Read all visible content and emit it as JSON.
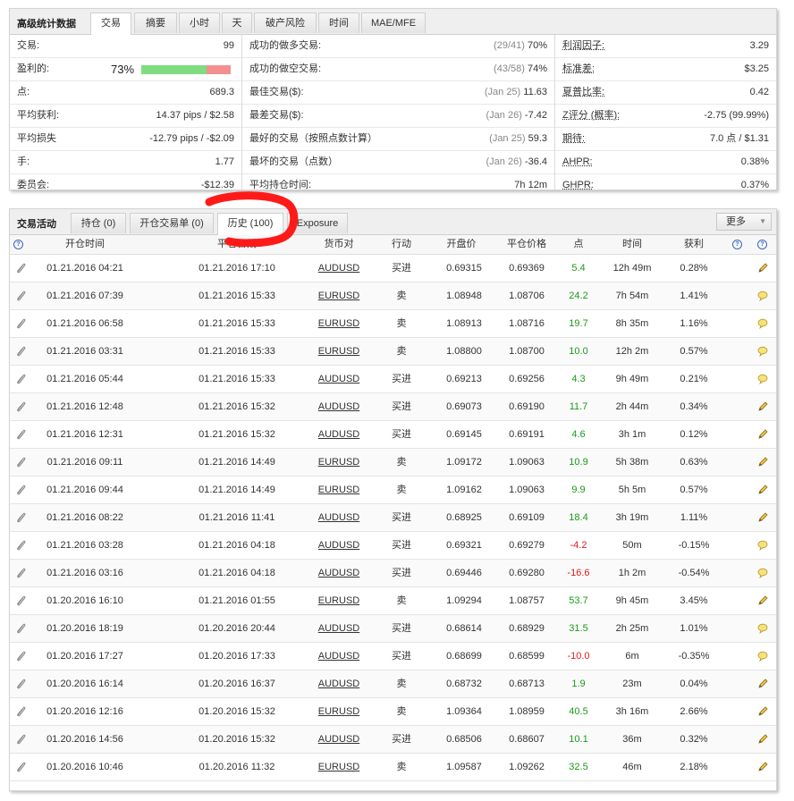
{
  "stats": {
    "title": "高级统计数据",
    "tabs": [
      "交易",
      "摘要",
      "小时",
      "天",
      "破产风险",
      "时间",
      "MAE/MFE"
    ],
    "active_tab": 0,
    "col1": [
      {
        "label": "交易:",
        "value": "99"
      },
      {
        "label": "盈利的:",
        "value": "73%",
        "win_fraction": 0.73
      },
      {
        "label": "点:",
        "value": "689.3"
      },
      {
        "label": "平均获利:",
        "value": "14.37 pips / $2.58"
      },
      {
        "label": "平均损失",
        "value": "-12.79 pips / -$2.09"
      },
      {
        "label": "手:",
        "value": "1.77"
      },
      {
        "label": "委员会:",
        "value": "-$12.39"
      }
    ],
    "col2": [
      {
        "label": "成功的做多交易:",
        "paren": "(29/41)",
        "value": "70%"
      },
      {
        "label": "成功的做空交易:",
        "paren": "(43/58)",
        "value": "74%"
      },
      {
        "label": "最佳交易($):",
        "paren": "(Jan 25)",
        "value": "11.63"
      },
      {
        "label": "最差交易($):",
        "paren": "(Jan 26)",
        "value": "-7.42"
      },
      {
        "label": "最好的交易（按照点数计算）",
        "paren": "(Jan 25)",
        "value": "59.3"
      },
      {
        "label": "最坏的交易（点数）",
        "paren": "(Jan 26)",
        "value": "-36.4"
      },
      {
        "label": "平均持仓时间:",
        "paren": "",
        "value": "7h 12m"
      }
    ],
    "col3": [
      {
        "label": "利润因子:",
        "value": "3.29"
      },
      {
        "label": "标准差:",
        "value": "$3.25"
      },
      {
        "label": "夏普比率:",
        "value": "0.42"
      },
      {
        "label": "Z评分 (概率):",
        "value": "-2.75 (99.99%)"
      },
      {
        "label": "期待:",
        "value": "7.0 点 / $1.31"
      },
      {
        "label": "AHPR:",
        "value": "0.38%"
      },
      {
        "label": "GHPR:",
        "value": "0.37%"
      }
    ]
  },
  "trades": {
    "title": "交易活动",
    "tabs": [
      "持仓 (0)",
      "开仓交易单 (0)",
      "历史 (100)",
      "Exposure"
    ],
    "active_tab": 2,
    "more_label": "更多",
    "headers": [
      "开仓时间",
      "平仓日期",
      "货币对",
      "行动",
      "开盘价",
      "平仓价格",
      "点",
      "时间",
      "获利"
    ],
    "rows": [
      {
        "open": "01.21.2016 04:21",
        "close": "01.21.2016 17:10",
        "symbol": "AUDUSD",
        "action": "买进",
        "open_price": "0.69315",
        "close_price": "0.69369",
        "pips": "5.4",
        "duration": "12h 49m",
        "profit": "0.28%",
        "icon": "pencil"
      },
      {
        "open": "01.21.2016 07:39",
        "close": "01.21.2016 15:33",
        "symbol": "EURUSD",
        "action": "卖",
        "open_price": "1.08948",
        "close_price": "1.08706",
        "pips": "24.2",
        "duration": "7h 54m",
        "profit": "1.41%",
        "icon": "comment"
      },
      {
        "open": "01.21.2016 06:58",
        "close": "01.21.2016 15:33",
        "symbol": "EURUSD",
        "action": "卖",
        "open_price": "1.08913",
        "close_price": "1.08716",
        "pips": "19.7",
        "duration": "8h 35m",
        "profit": "1.16%",
        "icon": "comment"
      },
      {
        "open": "01.21.2016 03:31",
        "close": "01.21.2016 15:33",
        "symbol": "EURUSD",
        "action": "卖",
        "open_price": "1.08800",
        "close_price": "1.08700",
        "pips": "10.0",
        "duration": "12h 2m",
        "profit": "0.57%",
        "icon": "comment"
      },
      {
        "open": "01.21.2016 05:44",
        "close": "01.21.2016 15:33",
        "symbol": "AUDUSD",
        "action": "买进",
        "open_price": "0.69213",
        "close_price": "0.69256",
        "pips": "4.3",
        "duration": "9h 49m",
        "profit": "0.21%",
        "icon": "comment"
      },
      {
        "open": "01.21.2016 12:48",
        "close": "01.21.2016 15:32",
        "symbol": "AUDUSD",
        "action": "买进",
        "open_price": "0.69073",
        "close_price": "0.69190",
        "pips": "11.7",
        "duration": "2h 44m",
        "profit": "0.34%",
        "icon": "pencil"
      },
      {
        "open": "01.21.2016 12:31",
        "close": "01.21.2016 15:32",
        "symbol": "AUDUSD",
        "action": "买进",
        "open_price": "0.69145",
        "close_price": "0.69191",
        "pips": "4.6",
        "duration": "3h 1m",
        "profit": "0.12%",
        "icon": "pencil"
      },
      {
        "open": "01.21.2016 09:11",
        "close": "01.21.2016 14:49",
        "symbol": "EURUSD",
        "action": "卖",
        "open_price": "1.09172",
        "close_price": "1.09063",
        "pips": "10.9",
        "duration": "5h 38m",
        "profit": "0.63%",
        "icon": "pencil"
      },
      {
        "open": "01.21.2016 09:44",
        "close": "01.21.2016 14:49",
        "symbol": "EURUSD",
        "action": "卖",
        "open_price": "1.09162",
        "close_price": "1.09063",
        "pips": "9.9",
        "duration": "5h 5m",
        "profit": "0.57%",
        "icon": "pencil"
      },
      {
        "open": "01.21.2016 08:22",
        "close": "01.21.2016 11:41",
        "symbol": "AUDUSD",
        "action": "买进",
        "open_price": "0.68925",
        "close_price": "0.69109",
        "pips": "18.4",
        "duration": "3h 19m",
        "profit": "1.11%",
        "icon": "pencil"
      },
      {
        "open": "01.21.2016 03:28",
        "close": "01.21.2016 04:18",
        "symbol": "AUDUSD",
        "action": "买进",
        "open_price": "0.69321",
        "close_price": "0.69279",
        "pips": "-4.2",
        "duration": "50m",
        "profit": "-0.15%",
        "icon": "comment"
      },
      {
        "open": "01.21.2016 03:16",
        "close": "01.21.2016 04:18",
        "symbol": "AUDUSD",
        "action": "买进",
        "open_price": "0.69446",
        "close_price": "0.69280",
        "pips": "-16.6",
        "duration": "1h 2m",
        "profit": "-0.54%",
        "icon": "comment"
      },
      {
        "open": "01.20.2016 16:10",
        "close": "01.21.2016 01:55",
        "symbol": "EURUSD",
        "action": "卖",
        "open_price": "1.09294",
        "close_price": "1.08757",
        "pips": "53.7",
        "duration": "9h 45m",
        "profit": "3.45%",
        "icon": "pencil"
      },
      {
        "open": "01.20.2016 18:19",
        "close": "01.20.2016 20:44",
        "symbol": "AUDUSD",
        "action": "买进",
        "open_price": "0.68614",
        "close_price": "0.68929",
        "pips": "31.5",
        "duration": "2h 25m",
        "profit": "1.01%",
        "icon": "comment"
      },
      {
        "open": "01.20.2016 17:27",
        "close": "01.20.2016 17:33",
        "symbol": "AUDUSD",
        "action": "买进",
        "open_price": "0.68699",
        "close_price": "0.68599",
        "pips": "-10.0",
        "duration": "6m",
        "profit": "-0.35%",
        "icon": "comment"
      },
      {
        "open": "01.20.2016 16:14",
        "close": "01.20.2016 16:37",
        "symbol": "AUDUSD",
        "action": "卖",
        "open_price": "0.68732",
        "close_price": "0.68713",
        "pips": "1.9",
        "duration": "23m",
        "profit": "0.04%",
        "icon": "pencil"
      },
      {
        "open": "01.20.2016 12:16",
        "close": "01.20.2016 15:32",
        "symbol": "EURUSD",
        "action": "卖",
        "open_price": "1.09364",
        "close_price": "1.08959",
        "pips": "40.5",
        "duration": "3h 16m",
        "profit": "2.66%",
        "icon": "pencil"
      },
      {
        "open": "01.20.2016 14:56",
        "close": "01.20.2016 15:32",
        "symbol": "AUDUSD",
        "action": "买进",
        "open_price": "0.68506",
        "close_price": "0.68607",
        "pips": "10.1",
        "duration": "36m",
        "profit": "0.32%",
        "icon": "pencil"
      },
      {
        "open": "01.20.2016 10:46",
        "close": "01.20.2016 11:32",
        "symbol": "EURUSD",
        "action": "卖",
        "open_price": "1.09587",
        "close_price": "1.09262",
        "pips": "32.5",
        "duration": "46m",
        "profit": "2.18%",
        "icon": "pencil"
      }
    ]
  },
  "colors": {
    "positive": "#1a9a1a",
    "negative": "#dd1a1a",
    "win_bar": "#7fdc7f",
    "loss_bar": "#f58f8f",
    "annotation": "#ff1a1a"
  }
}
